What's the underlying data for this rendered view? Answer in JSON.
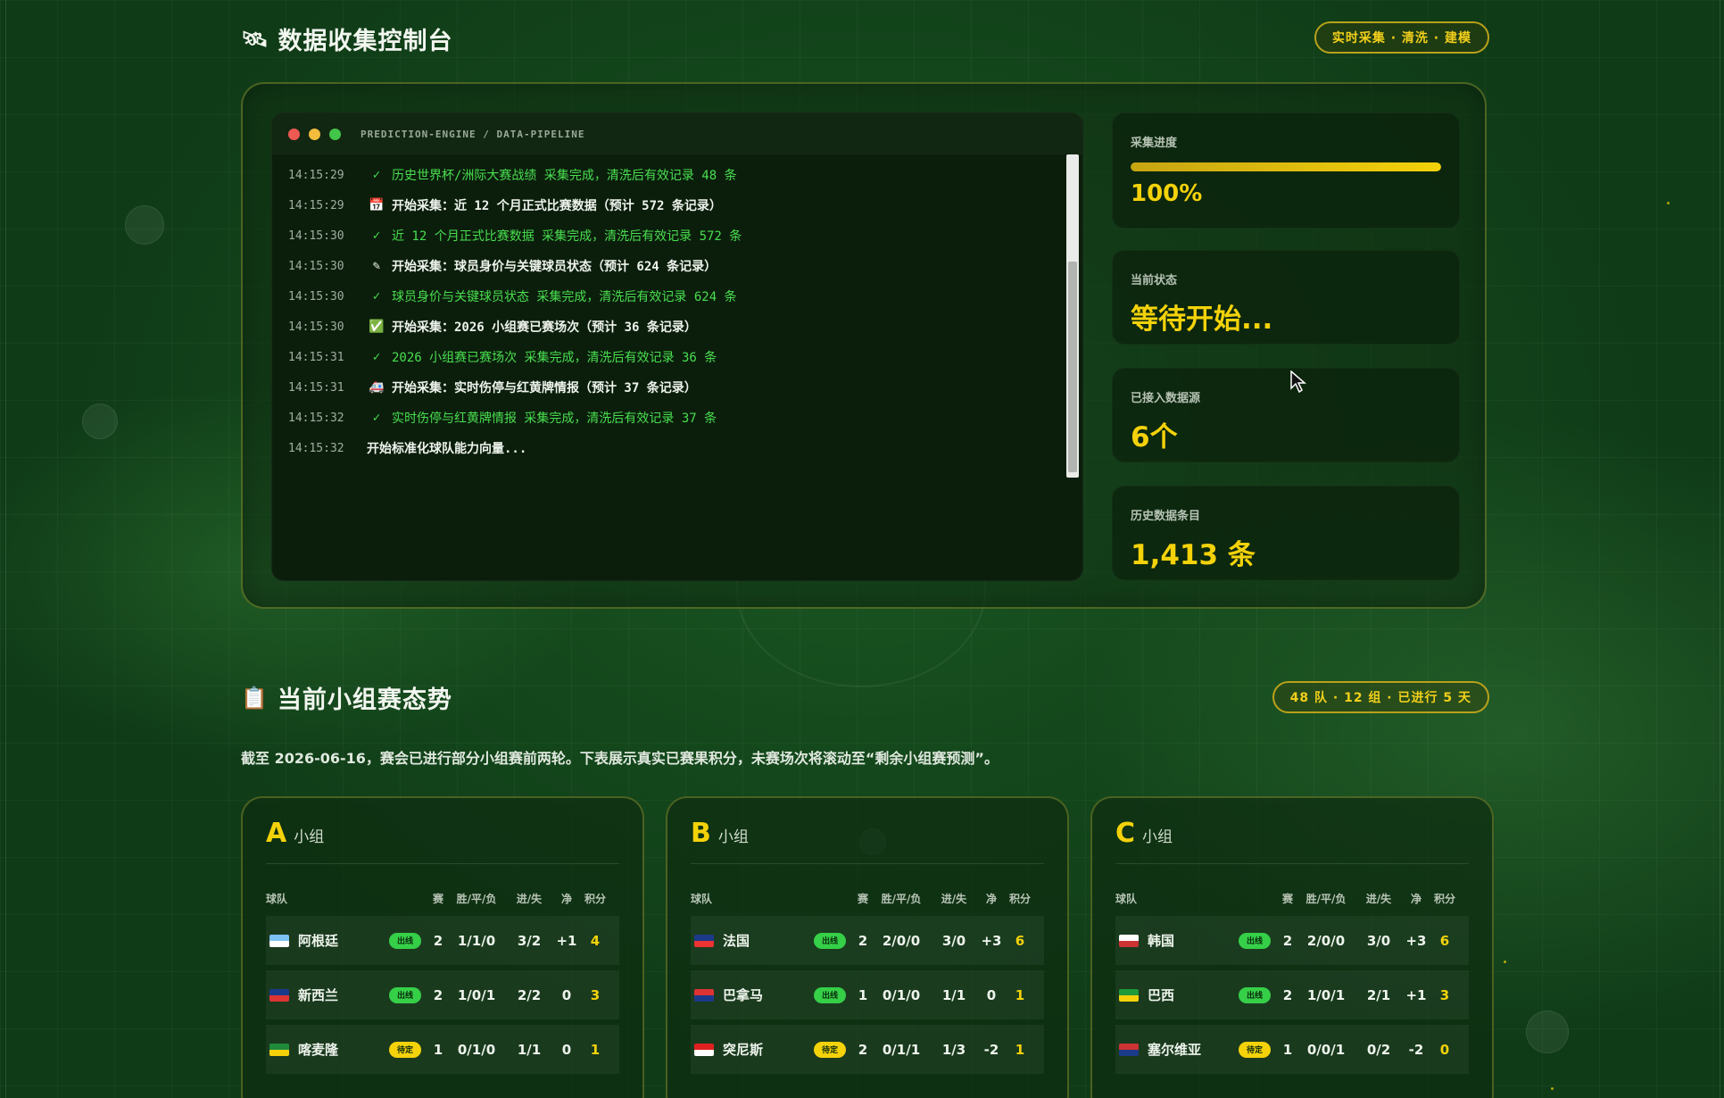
{
  "console": {
    "title": "数据收集控制台",
    "title_icon": "🛰",
    "tag": "实时采集 · 清洗 · 建模",
    "terminal_title": "PREDICTION-ENGINE / DATA-PIPELINE",
    "logs": [
      {
        "time": "14:15:29",
        "type": "ok",
        "icon": "✓",
        "text": "历史世界杯/洲际大赛战绩 采集完成，清洗后有效记录 48 条"
      },
      {
        "time": "14:15:29",
        "type": "start",
        "icon": "📅",
        "text": "开始采集：近 12 个月正式比赛数据（预计 572 条记录）"
      },
      {
        "time": "14:15:30",
        "type": "ok",
        "icon": "✓",
        "text": "近 12 个月正式比赛数据 采集完成，清洗后有效记录 572 条"
      },
      {
        "time": "14:15:30",
        "type": "start",
        "icon": "✎",
        "text": "开始采集：球员身价与关键球员状态（预计 624 条记录）"
      },
      {
        "time": "14:15:30",
        "type": "ok",
        "icon": "✓",
        "text": "球员身价与关键球员状态 采集完成，清洗后有效记录 624 条"
      },
      {
        "time": "14:15:30",
        "type": "start",
        "icon": "✅",
        "text": "开始采集：2026 小组赛已赛场次（预计 36 条记录）"
      },
      {
        "time": "14:15:31",
        "type": "ok",
        "icon": "✓",
        "text": "2026 小组赛已赛场次 采集完成，清洗后有效记录 36 条"
      },
      {
        "time": "14:15:31",
        "type": "start",
        "icon": "🚑",
        "text": "开始采集：实时伤停与红黄牌情报（预计 37 条记录）"
      },
      {
        "time": "14:15:32",
        "type": "ok",
        "icon": "✓",
        "text": "实时伤停与红黄牌情报 采集完成，清洗后有效记录 37 条"
      },
      {
        "time": "14:15:32",
        "type": "plain",
        "icon": "",
        "text": "开始标准化球队能力向量..."
      }
    ],
    "stats": {
      "progress_label": "采集进度",
      "progress_value": "100%",
      "progress_fraction": 1.0,
      "status_label": "当前状态",
      "status_value": "等待开始...",
      "sources_label": "已接入数据源",
      "sources_value": "6个",
      "history_label": "历史数据条目",
      "history_value": "1,413 条"
    }
  },
  "groups_section": {
    "title": "当前小组赛态势",
    "title_icon": "📋",
    "tag": "48 队 · 12 组 · 已进行 5 天",
    "subtitle": "截至 2026-06-16，赛会已进行部分小组赛前两轮。下表展示真实已赛果积分，未赛场次将滚动至“剩余小组赛预测”。",
    "headers": [
      "球队",
      "",
      "赛",
      "胜/平/负",
      "进/失",
      "净",
      "积分"
    ],
    "group_word": "小组",
    "groups": [
      {
        "letter": "A",
        "rows": [
          {
            "team": "阿根廷",
            "flag": [
              "#7cc2f2",
              "#ffffff"
            ],
            "badge": "出线",
            "badge_type": "q",
            "p": "2",
            "wdl": "1/1/0",
            "gf": "3/2",
            "gd": "+1",
            "pts": "4"
          },
          {
            "team": "新西兰",
            "flag": [
              "#1b3a8a",
              "#d33"
            ],
            "badge": "出线",
            "badge_type": "q",
            "p": "2",
            "wdl": "1/0/1",
            "gf": "2/2",
            "gd": "0",
            "pts": "3"
          },
          {
            "team": "喀麦隆",
            "flag": [
              "#1e8a3a",
              "#f4d20a"
            ],
            "badge": "待定",
            "badge_type": "p",
            "p": "1",
            "wdl": "0/1/0",
            "gf": "1/1",
            "gd": "0",
            "pts": "1"
          }
        ]
      },
      {
        "letter": "B",
        "rows": [
          {
            "team": "法国",
            "flag": [
              "#1b3a8a",
              "#e33"
            ],
            "badge": "出线",
            "badge_type": "q",
            "p": "2",
            "wdl": "2/0/0",
            "gf": "3/0",
            "gd": "+3",
            "pts": "6"
          },
          {
            "team": "巴拿马",
            "flag": [
              "#d33",
              "#1b3a8a"
            ],
            "badge": "出线",
            "badge_type": "q",
            "p": "1",
            "wdl": "0/1/0",
            "gf": "1/1",
            "gd": "0",
            "pts": "1"
          },
          {
            "team": "突尼斯",
            "flag": [
              "#e02020",
              "#ffffff"
            ],
            "badge": "待定",
            "badge_type": "p",
            "p": "2",
            "wdl": "0/1/1",
            "gf": "1/3",
            "gd": "-2",
            "pts": "1"
          }
        ]
      },
      {
        "letter": "C",
        "rows": [
          {
            "team": "韩国",
            "flag": [
              "#ffffff",
              "#c33"
            ],
            "badge": "出线",
            "badge_type": "q",
            "p": "2",
            "wdl": "2/0/0",
            "gf": "3/0",
            "gd": "+3",
            "pts": "6"
          },
          {
            "team": "巴西",
            "flag": [
              "#1f9a3a",
              "#f4d20a"
            ],
            "badge": "出线",
            "badge_type": "q",
            "p": "2",
            "wdl": "1/0/1",
            "gf": "2/1",
            "gd": "+1",
            "pts": "3"
          },
          {
            "team": "塞尔维亚",
            "flag": [
              "#c33",
              "#1b3a8a"
            ],
            "badge": "待定",
            "badge_type": "p",
            "p": "1",
            "wdl": "0/0/1",
            "gf": "0/2",
            "gd": "-2",
            "pts": "0"
          }
        ]
      }
    ]
  },
  "colors": {
    "accent": "#f4d20a",
    "ok": "#49df4f",
    "bg": "#154a1d"
  }
}
